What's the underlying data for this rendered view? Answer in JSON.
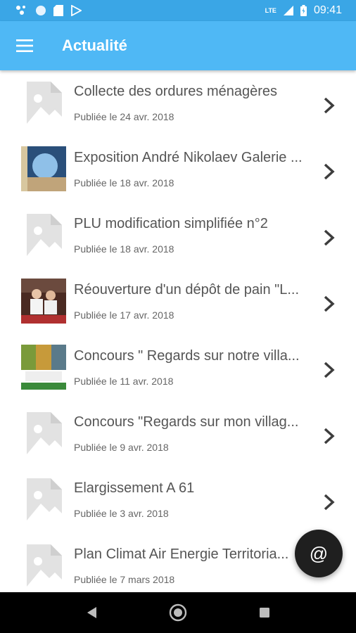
{
  "status_bar": {
    "network": "LTE",
    "time": "09:41"
  },
  "app_bar": {
    "title": "Actualité",
    "menu_icon": "hamburger-icon"
  },
  "news": [
    {
      "title": "Collecte des ordures ménagères",
      "date": "Publiée le 24 avr. 2018",
      "thumb": "placeholder-image-icon"
    },
    {
      "title": "Exposition André Nikolaev Galerie ...",
      "date": "Publiée le 18 avr. 2018",
      "thumb": "photo"
    },
    {
      "title": "PLU modification simplifiée n°2",
      "date": "Publiée le 18 avr. 2018",
      "thumb": "placeholder-image-icon"
    },
    {
      "title": "Réouverture d'un dépôt de pain \"L...",
      "date": "Publiée le 17 avr. 2018",
      "thumb": "photo"
    },
    {
      "title": "Concours \" Regards sur notre villa...",
      "date": "Publiée le 11 avr. 2018",
      "thumb": "photo"
    },
    {
      "title": "Concours \"Regards sur mon villag...",
      "date": "Publiée le 9 avr. 2018",
      "thumb": "placeholder-image-icon"
    },
    {
      "title": "Elargissement A 61",
      "date": "Publiée le 3 avr. 2018",
      "thumb": "placeholder-image-icon"
    },
    {
      "title": "Plan Climat Air Energie Territoria...",
      "date": "Publiée le 7 mars 2018",
      "thumb": "placeholder-image-icon"
    }
  ],
  "fab": {
    "label": "@"
  },
  "colors": {
    "status_bar": "#3aa6e6",
    "app_bar": "#4fb8f5",
    "fab": "#1f1f1f"
  }
}
